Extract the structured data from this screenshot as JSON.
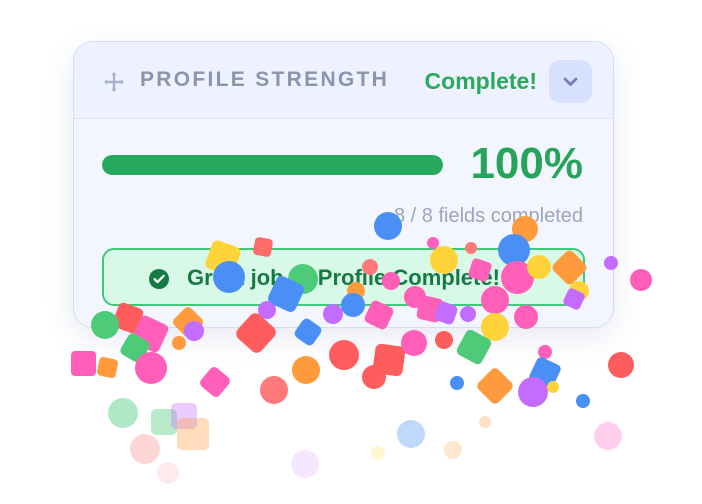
{
  "card": {
    "title": "PROFILE STRENGTH",
    "status_label": "Complete!",
    "progress": {
      "percent": 100,
      "display": "100%",
      "fields_text": "8 / 8 fields completed"
    },
    "success_banner": {
      "text": "Great job — Profile Complete!"
    }
  },
  "icons": {
    "drag_handle": "drag-handle-icon",
    "chevron": "chevron-down-icon",
    "check": "check-circle-icon"
  },
  "colors": {
    "accent_green": "#27A95D",
    "title_text": "#8B96AA",
    "card_background": "#F4F6FF",
    "chevron_background": "#D8E0FF",
    "banner_background": "#D8F9E7",
    "banner_border": "#43C77B"
  }
}
